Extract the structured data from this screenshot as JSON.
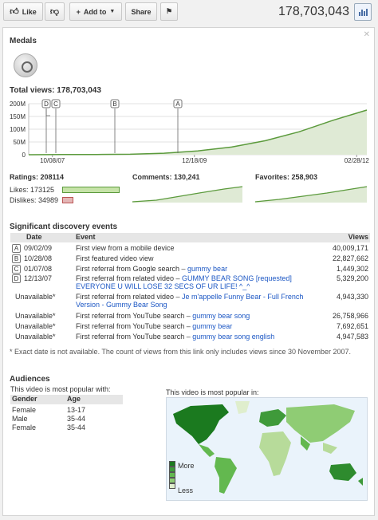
{
  "toolbar": {
    "like_label": "Like",
    "add_label": "Add to",
    "share_label": "Share",
    "views": "178,703,043"
  },
  "medals": {
    "title": "Medals"
  },
  "total": {
    "title": "Total views: 178,703,043",
    "markers": [
      "D",
      "C",
      "B",
      "A"
    ]
  },
  "chart_data": {
    "type": "area",
    "title": "Total views: 178,703,043",
    "ylim": [
      0,
      200
    ],
    "y_unit": "M",
    "yticks": [
      "200M",
      "150M",
      "100M",
      "50M",
      "0"
    ],
    "xticks": [
      "10/08/07",
      "12/18/09",
      "02/28/12"
    ],
    "x": [
      "10/08/07",
      "12/07",
      "06/08",
      "01/09",
      "06/09",
      "12/09",
      "06/10",
      "12/10",
      "06/11",
      "12/11",
      "02/28/12"
    ],
    "series": [
      {
        "values": [
          0,
          0.5,
          1,
          2,
          6,
          15,
          30,
          55,
          90,
          135,
          175
        ]
      }
    ],
    "events": [
      {
        "label": "D",
        "x": "12/13/07"
      },
      {
        "label": "C",
        "x": "01/07/08"
      },
      {
        "label": "B",
        "x": "10/28/08"
      },
      {
        "label": "A",
        "x": "09/02/09"
      }
    ],
    "fill": "#dfead5",
    "line": "#5b9a3c"
  },
  "stats": {
    "ratings": "Ratings: 208114",
    "likes": "Likes: 173125",
    "dislikes": "Dislikes: 34989",
    "likes_frac": 1.0,
    "dislikes_frac": 0.2,
    "comments": "Comments: 130,241",
    "favorites": "Favorites: 258,903"
  },
  "events": {
    "title": "Significant discovery events",
    "headers": {
      "date": "Date",
      "event": "Event",
      "views": "Views"
    },
    "rows": [
      {
        "marker": "A",
        "date": "09/02/09",
        "text": "First view from a mobile device",
        "link": "",
        "views": "40,009,171"
      },
      {
        "marker": "B",
        "date": "10/28/08",
        "text": "First featured video view",
        "link": "",
        "views": "22,827,662"
      },
      {
        "marker": "C",
        "date": "01/07/08",
        "text": "First referral from Google search – ",
        "link": "gummy bear",
        "views": "1,449,302"
      },
      {
        "marker": "D",
        "date": "12/13/07",
        "text": "First referral from related video – ",
        "link": "GUMMY BEAR SONG [requested] EVERYONE U WILL LOSE 32 SECS OF UR LIFE! ^_^",
        "views": "5,329,200"
      },
      {
        "marker": "",
        "date": "Unavailable*",
        "text": "First referral from related video – ",
        "link": "Je m'appelle Funny Bear - Full French Version - Gummy Bear Song",
        "views": "4,943,330"
      },
      {
        "marker": "",
        "date": "Unavailable*",
        "text": "First referral from YouTube search – ",
        "link": "gummy bear song",
        "views": "26,758,966"
      },
      {
        "marker": "",
        "date": "Unavailable*",
        "text": "First referral from YouTube search – ",
        "link": "gummy bear",
        "views": "7,692,651"
      },
      {
        "marker": "",
        "date": "Unavailable*",
        "text": "First referral from YouTube search – ",
        "link": "gummy bear song english",
        "views": "4,947,583"
      }
    ],
    "footnote": "* Exact date is not available. The count of views from this link only includes views since 30 November 2007."
  },
  "audiences": {
    "title": "Audiences",
    "popular_with": "This video is most popular with:",
    "headers": {
      "gender": "Gender",
      "age": "Age"
    },
    "rows": [
      {
        "gender": "Female",
        "age": "13-17"
      },
      {
        "gender": "Male",
        "age": "35-44"
      },
      {
        "gender": "Female",
        "age": "35-44"
      }
    ],
    "popular_in": "This video is most popular in:",
    "legend_more": "More",
    "legend_less": "Less"
  }
}
